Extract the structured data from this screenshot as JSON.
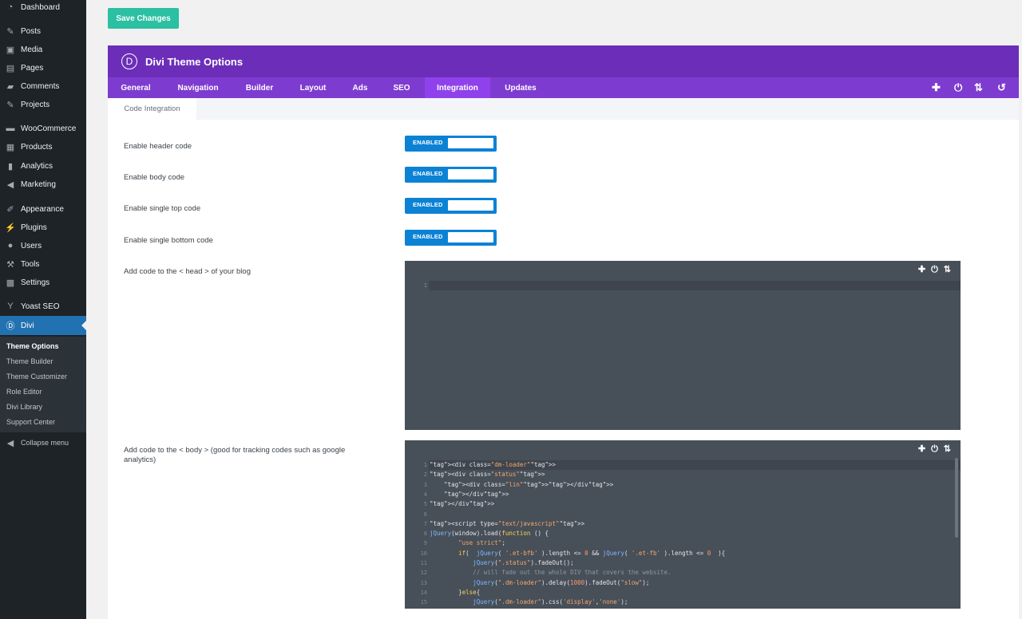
{
  "sidebar": {
    "menu": [
      {
        "label": "Dashboard",
        "icon": "dashboard-icon"
      },
      {
        "label": "Posts",
        "icon": "pin-icon"
      },
      {
        "label": "Media",
        "icon": "media-icon"
      },
      {
        "label": "Pages",
        "icon": "pages-icon"
      },
      {
        "label": "Comments",
        "icon": "comments-icon"
      },
      {
        "label": "Projects",
        "icon": "pin-icon"
      },
      {
        "label": "WooCommerce",
        "icon": "woocommerce-icon"
      },
      {
        "label": "Products",
        "icon": "products-icon"
      },
      {
        "label": "Analytics",
        "icon": "analytics-icon"
      },
      {
        "label": "Marketing",
        "icon": "megaphone-icon"
      },
      {
        "label": "Appearance",
        "icon": "brush-icon"
      },
      {
        "label": "Plugins",
        "icon": "plugin-icon"
      },
      {
        "label": "Users",
        "icon": "user-icon"
      },
      {
        "label": "Tools",
        "icon": "wrench-icon"
      },
      {
        "label": "Settings",
        "icon": "settings-icon"
      },
      {
        "label": "Yoast SEO",
        "icon": "yoast-icon"
      },
      {
        "label": "Divi",
        "icon": "divi-icon"
      }
    ],
    "submenu": [
      "Theme Options",
      "Theme Builder",
      "Theme Customizer",
      "Role Editor",
      "Divi Library",
      "Support Center"
    ],
    "collapse_label": "Collapse menu"
  },
  "save_button": "Save Changes",
  "panel": {
    "logo_letter": "D",
    "title": "Divi Theme Options",
    "tabs": [
      "General",
      "Navigation",
      "Builder",
      "Layout",
      "Ads",
      "SEO",
      "Integration",
      "Updates"
    ],
    "active_tab": "Integration",
    "header_icons": [
      "plus-icon",
      "power-icon",
      "sort-icon",
      "undo-icon"
    ],
    "subtab": "Code Integration"
  },
  "settings": {
    "toggle_label": "ENABLED",
    "rows": [
      "Enable header code",
      "Enable body code",
      "Enable single top code",
      "Enable single bottom code"
    ],
    "head_code_label": "Add code to the < head > of your blog",
    "body_code_label": "Add code to the < body > (good for tracking codes such as google analytics)"
  },
  "head_editor": {
    "line_numbers": [
      "1"
    ]
  },
  "body_editor": {
    "line_numbers": [
      "1",
      "2",
      "3",
      "4",
      "5",
      "6",
      "7",
      "8",
      "9",
      "10",
      "11",
      "12",
      "13",
      "14",
      "15"
    ],
    "code": [
      "<div class=\"dm-loader\">",
      "<div class=\"status\">",
      "    <div class=\"lin\"></div>",
      "    </div>",
      "</div>",
      "",
      "<script type=\"text/javascript\">",
      "jQuery(window).load(function () {",
      "        \"use strict\";",
      "        if(  jQuery( '.et-bfb' ).length <= 0 && jQuery( '.et-fb' ).length <= 0  ){",
      "            jQuery(\".status\").fadeOut();",
      "            // will fade out the whole DIV that covers the website.",
      "            jQuery(\".dm-loader\").delay(1000).fadeOut(\"slow\");",
      "        }else{",
      "            jQuery(\".dm-loader\").css('display','none');"
    ]
  },
  "colors": {
    "accent": "#6c2eb9",
    "tabs": "#7e3bd0",
    "toggle": "#0c82d5",
    "save": "#2bc0a1",
    "editor": "#474f59"
  }
}
